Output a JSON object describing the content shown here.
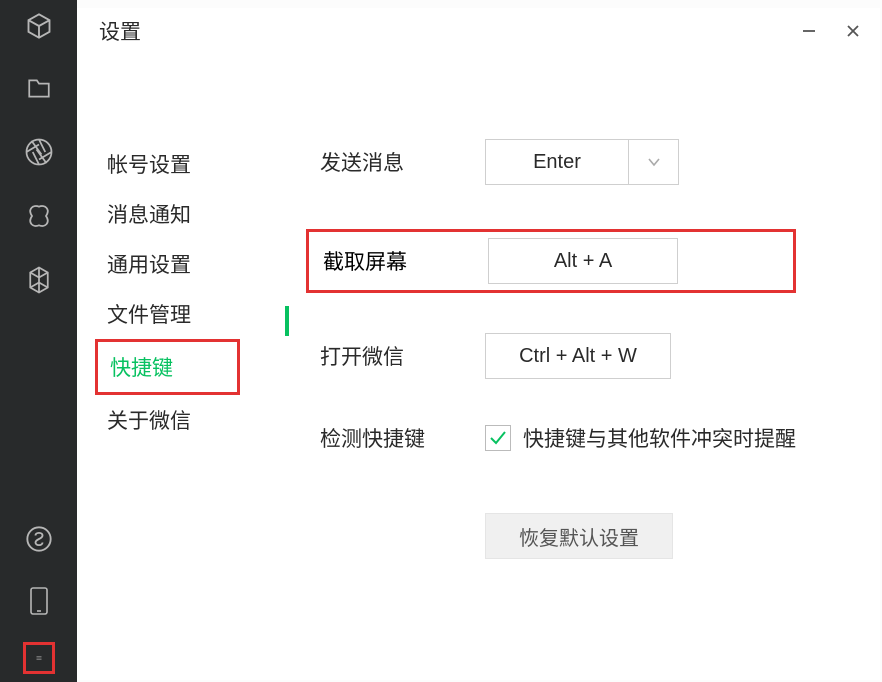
{
  "window": {
    "title": "设置"
  },
  "nav": {
    "items": [
      {
        "label": "帐号设置"
      },
      {
        "label": "消息通知"
      },
      {
        "label": "通用设置"
      },
      {
        "label": "文件管理"
      },
      {
        "label": "快捷键",
        "selected": true,
        "highlight": true
      },
      {
        "label": "关于微信"
      }
    ]
  },
  "main": {
    "send_message": {
      "label": "发送消息",
      "value": "Enter"
    },
    "screenshot": {
      "label": "截取屏幕",
      "value": "Alt + A",
      "highlight": true
    },
    "open_wechat": {
      "label": "打开微信",
      "value": "Ctrl + Alt + W"
    },
    "detect": {
      "label": "检测快捷键",
      "text": "快捷键与其他软件冲突时提醒",
      "checked": true
    },
    "restore": {
      "label": "恢复默认设置"
    }
  }
}
